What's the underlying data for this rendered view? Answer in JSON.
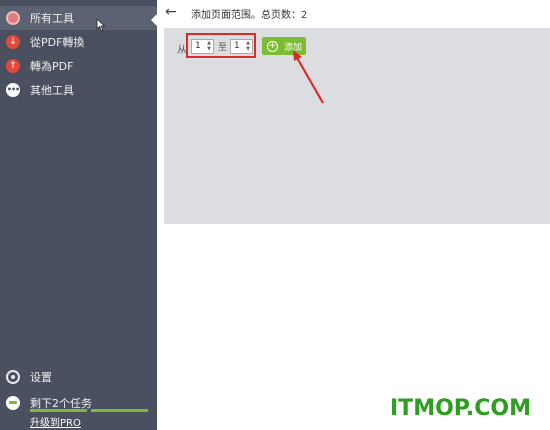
{
  "sidebar": {
    "items": [
      {
        "label": "所有工具",
        "icon": "all-tools-icon",
        "active": true
      },
      {
        "label": "從PDF轉換",
        "icon": "download-arrow-icon"
      },
      {
        "label": "轉為PDF",
        "icon": "upload-arrow-icon"
      },
      {
        "label": "其他工具",
        "icon": "more-dots-icon"
      }
    ],
    "settings_label": "设置",
    "tasks_label": "剩下2个任务",
    "upgrade_label": "升级到PRO"
  },
  "header": {
    "title": "添加页面范围。总页数：2"
  },
  "range": {
    "from_label": "从",
    "to_label": "至",
    "from_value": "1",
    "to_value": "1",
    "add_label": "添加"
  },
  "watermark": "ITMOP.COM",
  "colors": {
    "sidebar_bg": "#4a5060",
    "accent_green": "#7dbb34",
    "highlight_red": "#d92c2c",
    "panel_bg": "#dcdde0"
  }
}
